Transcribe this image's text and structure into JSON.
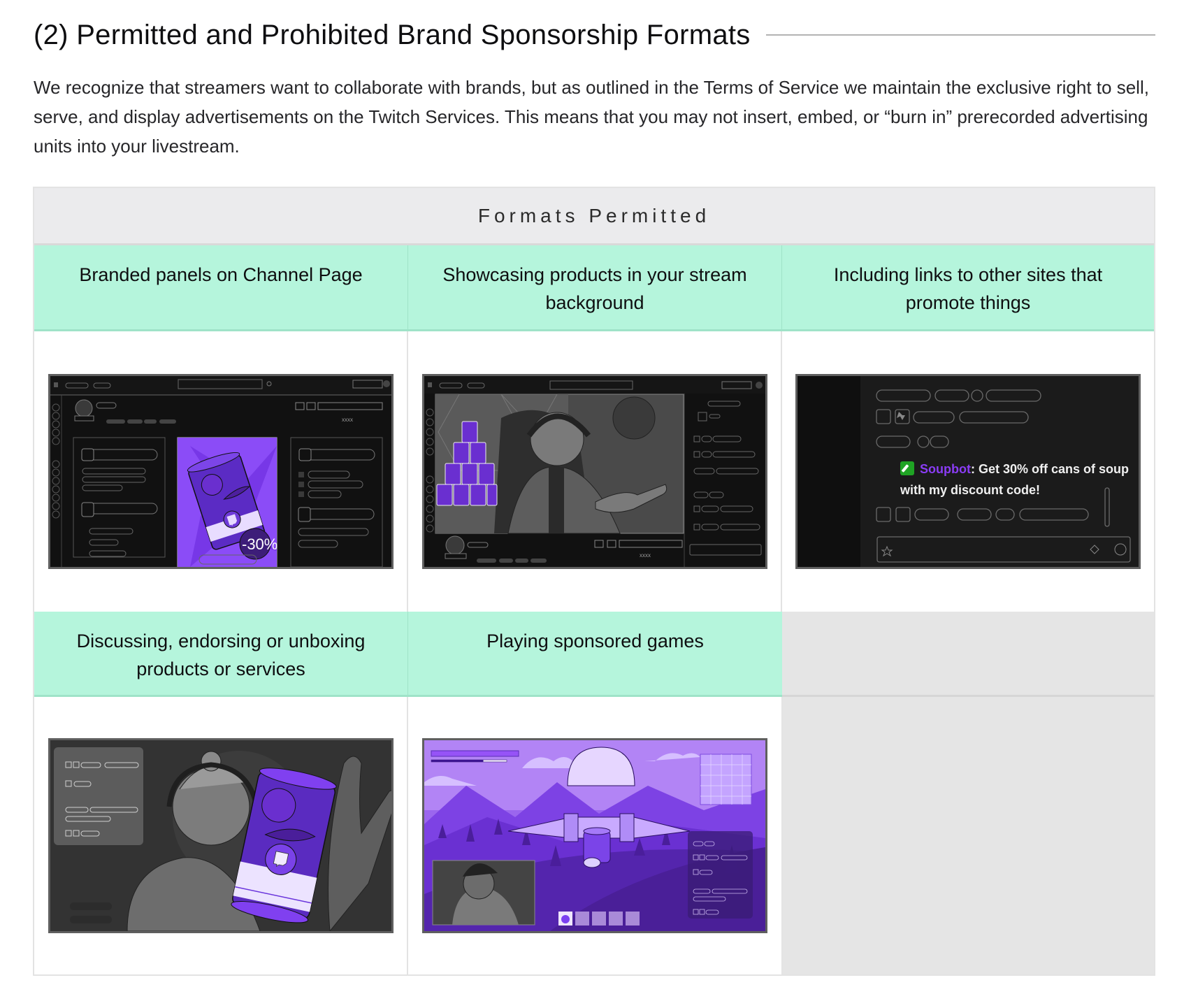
{
  "section": {
    "heading": "(2) Permitted and Prohibited Brand Sponsorship Formats",
    "intro": "We recognize that streamers want to collaborate with brands, but as outlined in the Terms of Service we maintain the exclusive right to sell, serve, and display advertisements on the Twitch Services. This means that you may not insert, embed, or “burn in” prerecorded advertising units into your livestream."
  },
  "table": {
    "caption": "Formats Permitted",
    "colors": {
      "caption_bg": "#ebebed",
      "cell_header_bg": "#b5f5dc",
      "empty_cell_bg": "#e5e5e5",
      "brand_purple": "#8a3cf5"
    },
    "items": [
      {
        "label": "Branded panels on Channel Page",
        "illustration": "channel-page-with-branded-soup-panel",
        "illustration_text": {
          "viewer_count": "xxxx",
          "discount": "-30%"
        }
      },
      {
        "label": "Showcasing products in your stream background",
        "illustration": "streamer-with-soup-cans-in-background",
        "illustration_text": {
          "viewer_count": "xxxx"
        }
      },
      {
        "label": "Including links to other sites that promote things",
        "illustration": "chat-with-promo-link",
        "illustration_text": {
          "chat_user": "Soupbot",
          "chat_separator": ": ",
          "chat_message": "Get 30% off cans of soup with my discount code!"
        }
      },
      {
        "label": "Discussing, endorsing or unboxing products or services",
        "illustration": "streamer-holding-soup-can"
      },
      {
        "label": "Playing sponsored games",
        "illustration": "sponsored-game-stream",
        "illustration_values": {
          "health_bar_fill": 0.69,
          "inventory_slots": 5,
          "filled_slots": 1
        }
      }
    ]
  }
}
